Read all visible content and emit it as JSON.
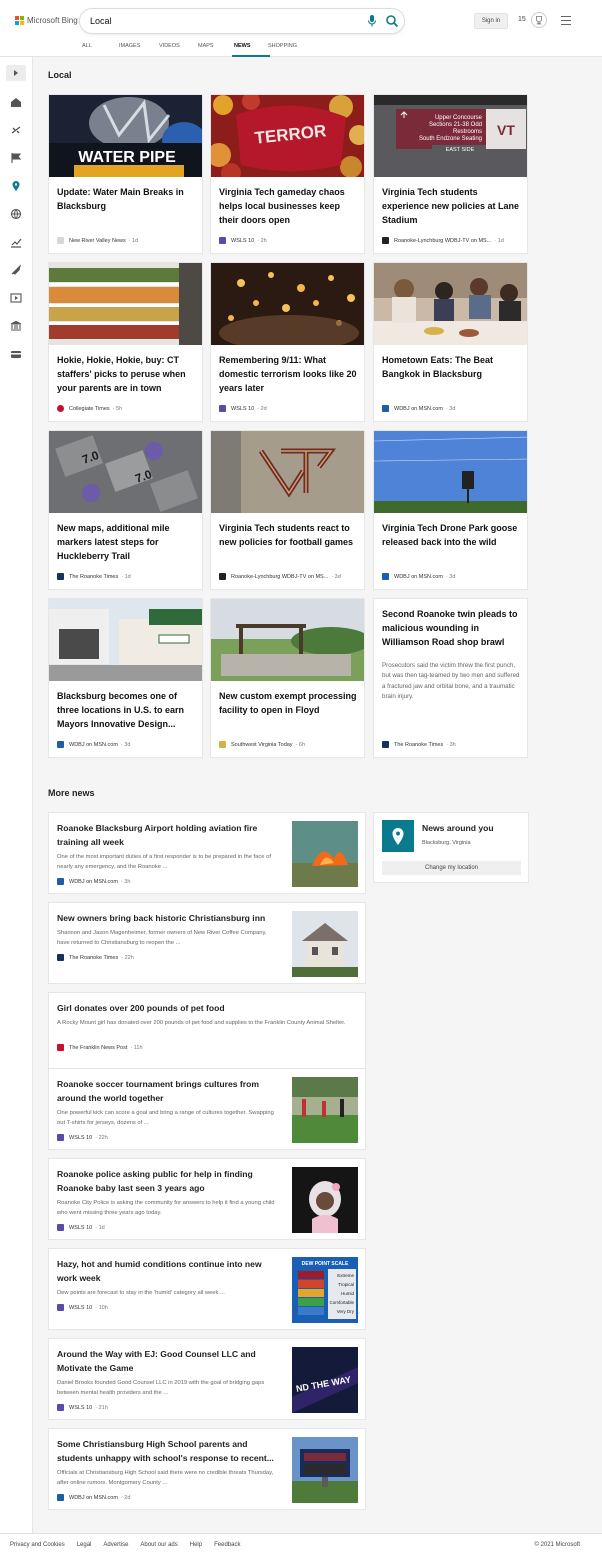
{
  "header": {
    "logo_text": "Microsoft Bing",
    "search_value": "Local",
    "signin_label": "Sign in",
    "rewards_count": "15",
    "tabs": [
      {
        "label": "ALL"
      },
      {
        "label": "IMAGES"
      },
      {
        "label": "VIDEOS"
      },
      {
        "label": "MAPS"
      },
      {
        "label": "NEWS",
        "active": true
      },
      {
        "label": "SHOPPING"
      }
    ]
  },
  "sidebar": {
    "icons": [
      "expand-icon",
      "home-icon",
      "satellite-icon",
      "flag-icon",
      "location-pin-icon",
      "globe-icon",
      "chart-icon",
      "rocket-icon",
      "video-icon",
      "bank-icon",
      "card-icon"
    ]
  },
  "local": {
    "title": "Local",
    "cards": [
      {
        "title": "Update: Water Main Breaks in Blacksburg",
        "source": "New River Valley News",
        "age": "· 1d",
        "img_text": "WATER PIPE"
      },
      {
        "title": "Virginia Tech gameday chaos helps local businesses keep their doors open",
        "source": "WSLS 10",
        "age": "· 2h"
      },
      {
        "title": "Virginia Tech students experience new policies at Lane Stadium",
        "source": "Roanoke-Lynchburg WDBJ-TV on MS...",
        "age": "· 1d",
        "img_lines": [
          "Upper Concourse",
          "Sections 21-38 Odd",
          "Restrooms",
          "South Endzone Seating",
          "EAST SIDE"
        ]
      },
      {
        "title": "Hokie, Hokie, Hokie, buy: CT staffers' picks to peruse when your parents are in town",
        "source": "Collegiate Times",
        "age": "· 5h"
      },
      {
        "title": "Remembering 9/11: What domestic terrorism looks like 20 years later",
        "source": "WSLS 10",
        "age": "· 2d"
      },
      {
        "title": "Hometown Eats: The Beat Bangkok in Blacksburg",
        "source": "WDBJ on MSN.com",
        "age": "· 3d"
      },
      {
        "title": "New maps, additional mile markers latest steps for Huckleberry Trail",
        "source": "The Roanoke Times",
        "age": "· 1d"
      },
      {
        "title": "Virginia Tech students react to new policies for football games",
        "source": "Roanoke-Lynchburg WDBJ-TV on MS...",
        "age": "· 3d"
      },
      {
        "title": "Virginia Tech Drone Park goose released back into the wild",
        "source": "WDBJ on MSN.com",
        "age": "· 3d"
      },
      {
        "title": "Blacksburg becomes one of three locations in U.S. to earn Mayors Innovative Design...",
        "source": "WDBJ on MSN.com",
        "age": "· 3d"
      },
      {
        "title": "New custom exempt processing facility to open in Floyd",
        "source": "Southwest Virginia Today",
        "age": "· 6h"
      },
      {
        "title": "Second Roanoke twin pleads to malicious wounding in Williamson Road shop brawl",
        "snippet": "Prosecutors said the victim threw the first punch, but was then tag-teamed by two men and suffered a fractured jaw and orbital bone, and a traumatic brain injury.",
        "source": "The Roanoke Times",
        "age": "· 3h"
      }
    ]
  },
  "more_news": {
    "title": "More news",
    "items": [
      {
        "title": "Roanoke Blacksburg Airport holding aviation fire training all week",
        "snippet": "One of the most important duties of a first responder is to be prepared in the face of nearly any emergency, and the Roanoke ...",
        "source": "WDBJ on MSN.com",
        "age": "· 3h"
      },
      {
        "title": "New owners bring back historic Christiansburg inn",
        "snippet": "Shannon and Jason Magenheimer, former owners of New River Coffee Company, have returned to Christiansburg to reopen the ...",
        "source": "The Roanoke Times",
        "age": "· 22h"
      },
      {
        "title": "Girl donates over 200 pounds of pet food",
        "snippet": "A Rocky Mount girl has donated over 200 pounds of pet food and supplies to the Franklin County Animal Shelter.",
        "source": "The Franklin News Post",
        "age": "· 11h"
      },
      {
        "title": "Roanoke soccer tournament brings cultures from around the world together",
        "snippet": "One powerful kick can score a goal and bring a range of cultures together. Swapping out T-shirts for jerseys, dozens of ...",
        "source": "WSLS 10",
        "age": "· 22h"
      },
      {
        "title": "Roanoke police asking public for help in finding Roanoke baby last seen 3 years ago",
        "snippet": "Roanoke City Police is asking the community for answers to help it find a young child who went missing three years ago today.",
        "source": "WSLS 10",
        "age": "· 1d"
      },
      {
        "title": "Hazy, hot and humid conditions continue into new work week",
        "snippet": "Dew points are forecast to stay in the 'humid' category all week ...",
        "source": "WSLS 10",
        "age": "· 10h",
        "thumb_lines": [
          "DEW POINT SCALE",
          "Extreme",
          "Tropical",
          "Humid",
          "Comfortable",
          "Very Dry"
        ]
      },
      {
        "title": "Around the Way with EJ: Good Counsel LLC and Motivate the Game",
        "snippet": "Daniel Brooks founded Good Counsel LLC in 2019 with the goal of bridging gaps between mental health providers and the ...",
        "source": "WSLS 10",
        "age": "· 21h",
        "thumb_text": "ND THE WAY"
      },
      {
        "title": "Some Christiansburg High School parents and students unhappy with school's response to recent...",
        "snippet": "Officials at Christiansburg High School said there were no credible threats Thursday, after online rumors. Montgomery County ...",
        "source": "WDBJ on MSN.com",
        "age": "· 2d"
      }
    ]
  },
  "location": {
    "title": "News around you",
    "city": "Blacksburg, Virginia",
    "button": "Change my location"
  },
  "footer": {
    "links": [
      "Privacy and Cookies",
      "Legal",
      "Advertise",
      "About our ads",
      "Help",
      "Feedback"
    ],
    "copyright": "© 2021 Microsoft"
  },
  "colors": {
    "accent": "#0b7a8c",
    "wsls": "#5b4aa8",
    "wdbj": "#1d5ea8",
    "collegiate": "#c8102e",
    "roanoke_times": "#14335c"
  }
}
